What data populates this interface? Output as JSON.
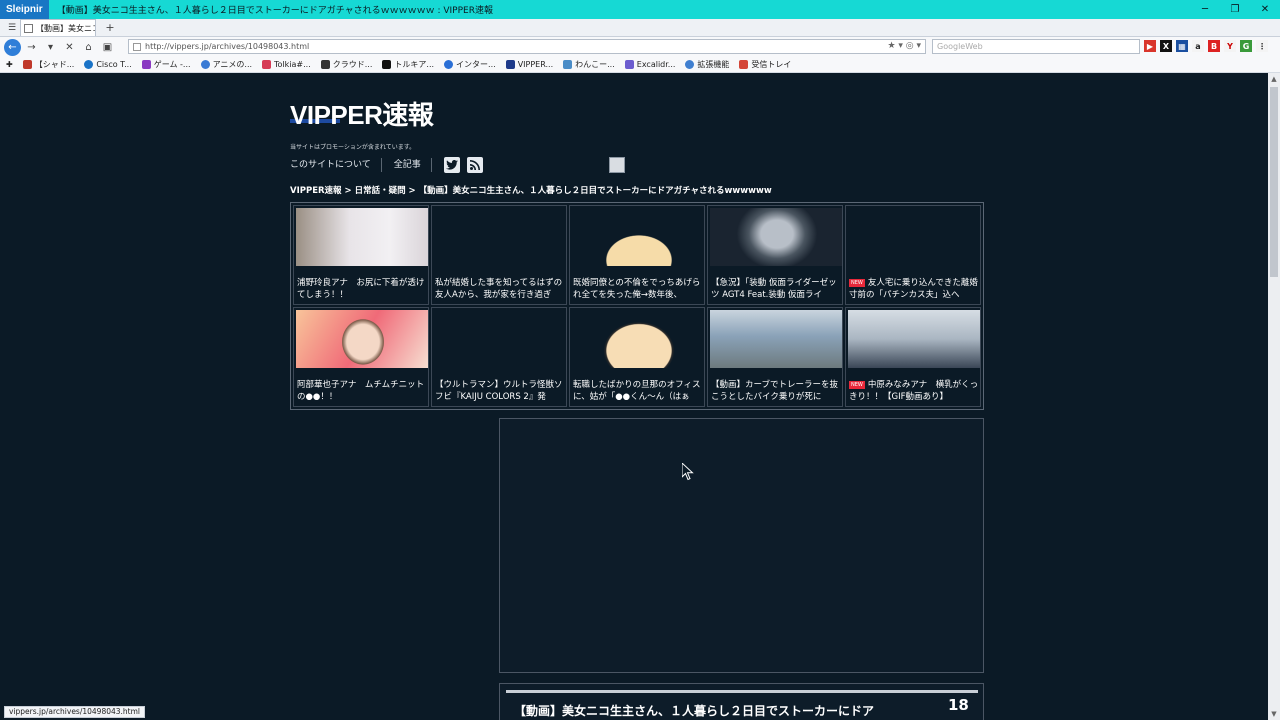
{
  "window": {
    "app_name": "Sleipnir",
    "title": "【動画】美女ニコ生主さん、１人暮らし２日目でストーカーにドアガチャされるｗｗｗｗｗｗ : VIPPER速報",
    "min": "─",
    "restore": "❐",
    "close": "✕"
  },
  "tabs": [
    {
      "label": "【動画】美女ニコ..."
    }
  ],
  "navbar": {
    "url": "http://vippers.jp/archives/10498043.html",
    "search_placeholder": "GoogleWeb"
  },
  "bookmarks": [
    {
      "label": "【シャド...",
      "color": "#c0392b"
    },
    {
      "label": "Cisco T...",
      "color": "#1a73c7"
    },
    {
      "label": "ゲーム -...",
      "color": "#8a3ac2"
    },
    {
      "label": "アニメの...",
      "color": "#3a7bd5"
    },
    {
      "label": "Tolkia#...",
      "color": "#d63b55"
    },
    {
      "label": "クラウド...",
      "color": "#333333"
    },
    {
      "label": "トルキア...",
      "color": "#111111"
    },
    {
      "label": "インター...",
      "color": "#2a6fd6"
    },
    {
      "label": "VIPPER...",
      "color": "#1d3a8a"
    },
    {
      "label": "わんこー...",
      "color": "#4a8cc7"
    },
    {
      "label": "Excalidr...",
      "color": "#6b5ccf"
    },
    {
      "label": "拡張機能",
      "color": "#3f7fd0"
    },
    {
      "label": "受信トレイ",
      "color": "#d44638"
    }
  ],
  "site": {
    "logo": "VIPPER速報",
    "promo": "当サイトはプロモーションが含まれています。",
    "nav": [
      "このサイトについて",
      "全記事"
    ],
    "breadcrumb": "VIPPER速報 > 日常話・疑問 > 【動画】美女ニコ生主さん、１人暮らし２日目でストーカーにドアガチャされるwwwwww"
  },
  "grid_items": [
    {
      "title": "浦野玲良アナ　お尻に下着が透けてしまう！！",
      "new": false,
      "thumb": "#d8d2d6"
    },
    {
      "title": "私が結婚した事を知ってるはずの友人Aから、我が家を行き過ぎ",
      "new": false,
      "thumb": "#0b1a26"
    },
    {
      "title": "既婚同僚との不倫をでっちあげられ全てを失った俺→数年後、",
      "new": false,
      "thumb": "#f0e6c8"
    },
    {
      "title": "【急況】「装動 仮面ライダーゼッツ AGT4 Feat.装動 仮面ライ",
      "new": false,
      "thumb": "#3b4048"
    },
    {
      "title": "友人宅に乗り込んできた離婚寸前の「パチンカス夫」込へ",
      "new": true,
      "thumb": "#0b1a26"
    },
    {
      "title": "阿部華也子アナ　ムチムチニットの●●！！",
      "new": false,
      "thumb": "#f2a3a8"
    },
    {
      "title": "【ウルトラマン】ウルトラ怪獣ソフビ『KAIJU COLORS 2』発",
      "new": false,
      "thumb": "#0b1a26"
    },
    {
      "title": "転職したばかりの旦那のオフィスに、姑が「●●くん〜ん（はぁ",
      "new": false,
      "thumb": "#f5d9b8"
    },
    {
      "title": "【動画】カーブでトレーラーを抜こうとしたバイク乗りが死に",
      "new": false,
      "thumb": "#8aa2b8"
    },
    {
      "title": "中原みなみアナ　横乳がくっきり！！【GIF動画あり】",
      "new": true,
      "thumb": "#b9c4cf"
    }
  ],
  "article": {
    "title": "【動画】美女ニコ生主さん、１人暮らし２日目でストーカーにドア",
    "count": "18"
  },
  "status": "vippers.jp/archives/10498043.html",
  "colors": {
    "page_bg": "#0b1a26",
    "titlebar": "#16d9d4",
    "new_badge": "#e8283a"
  }
}
